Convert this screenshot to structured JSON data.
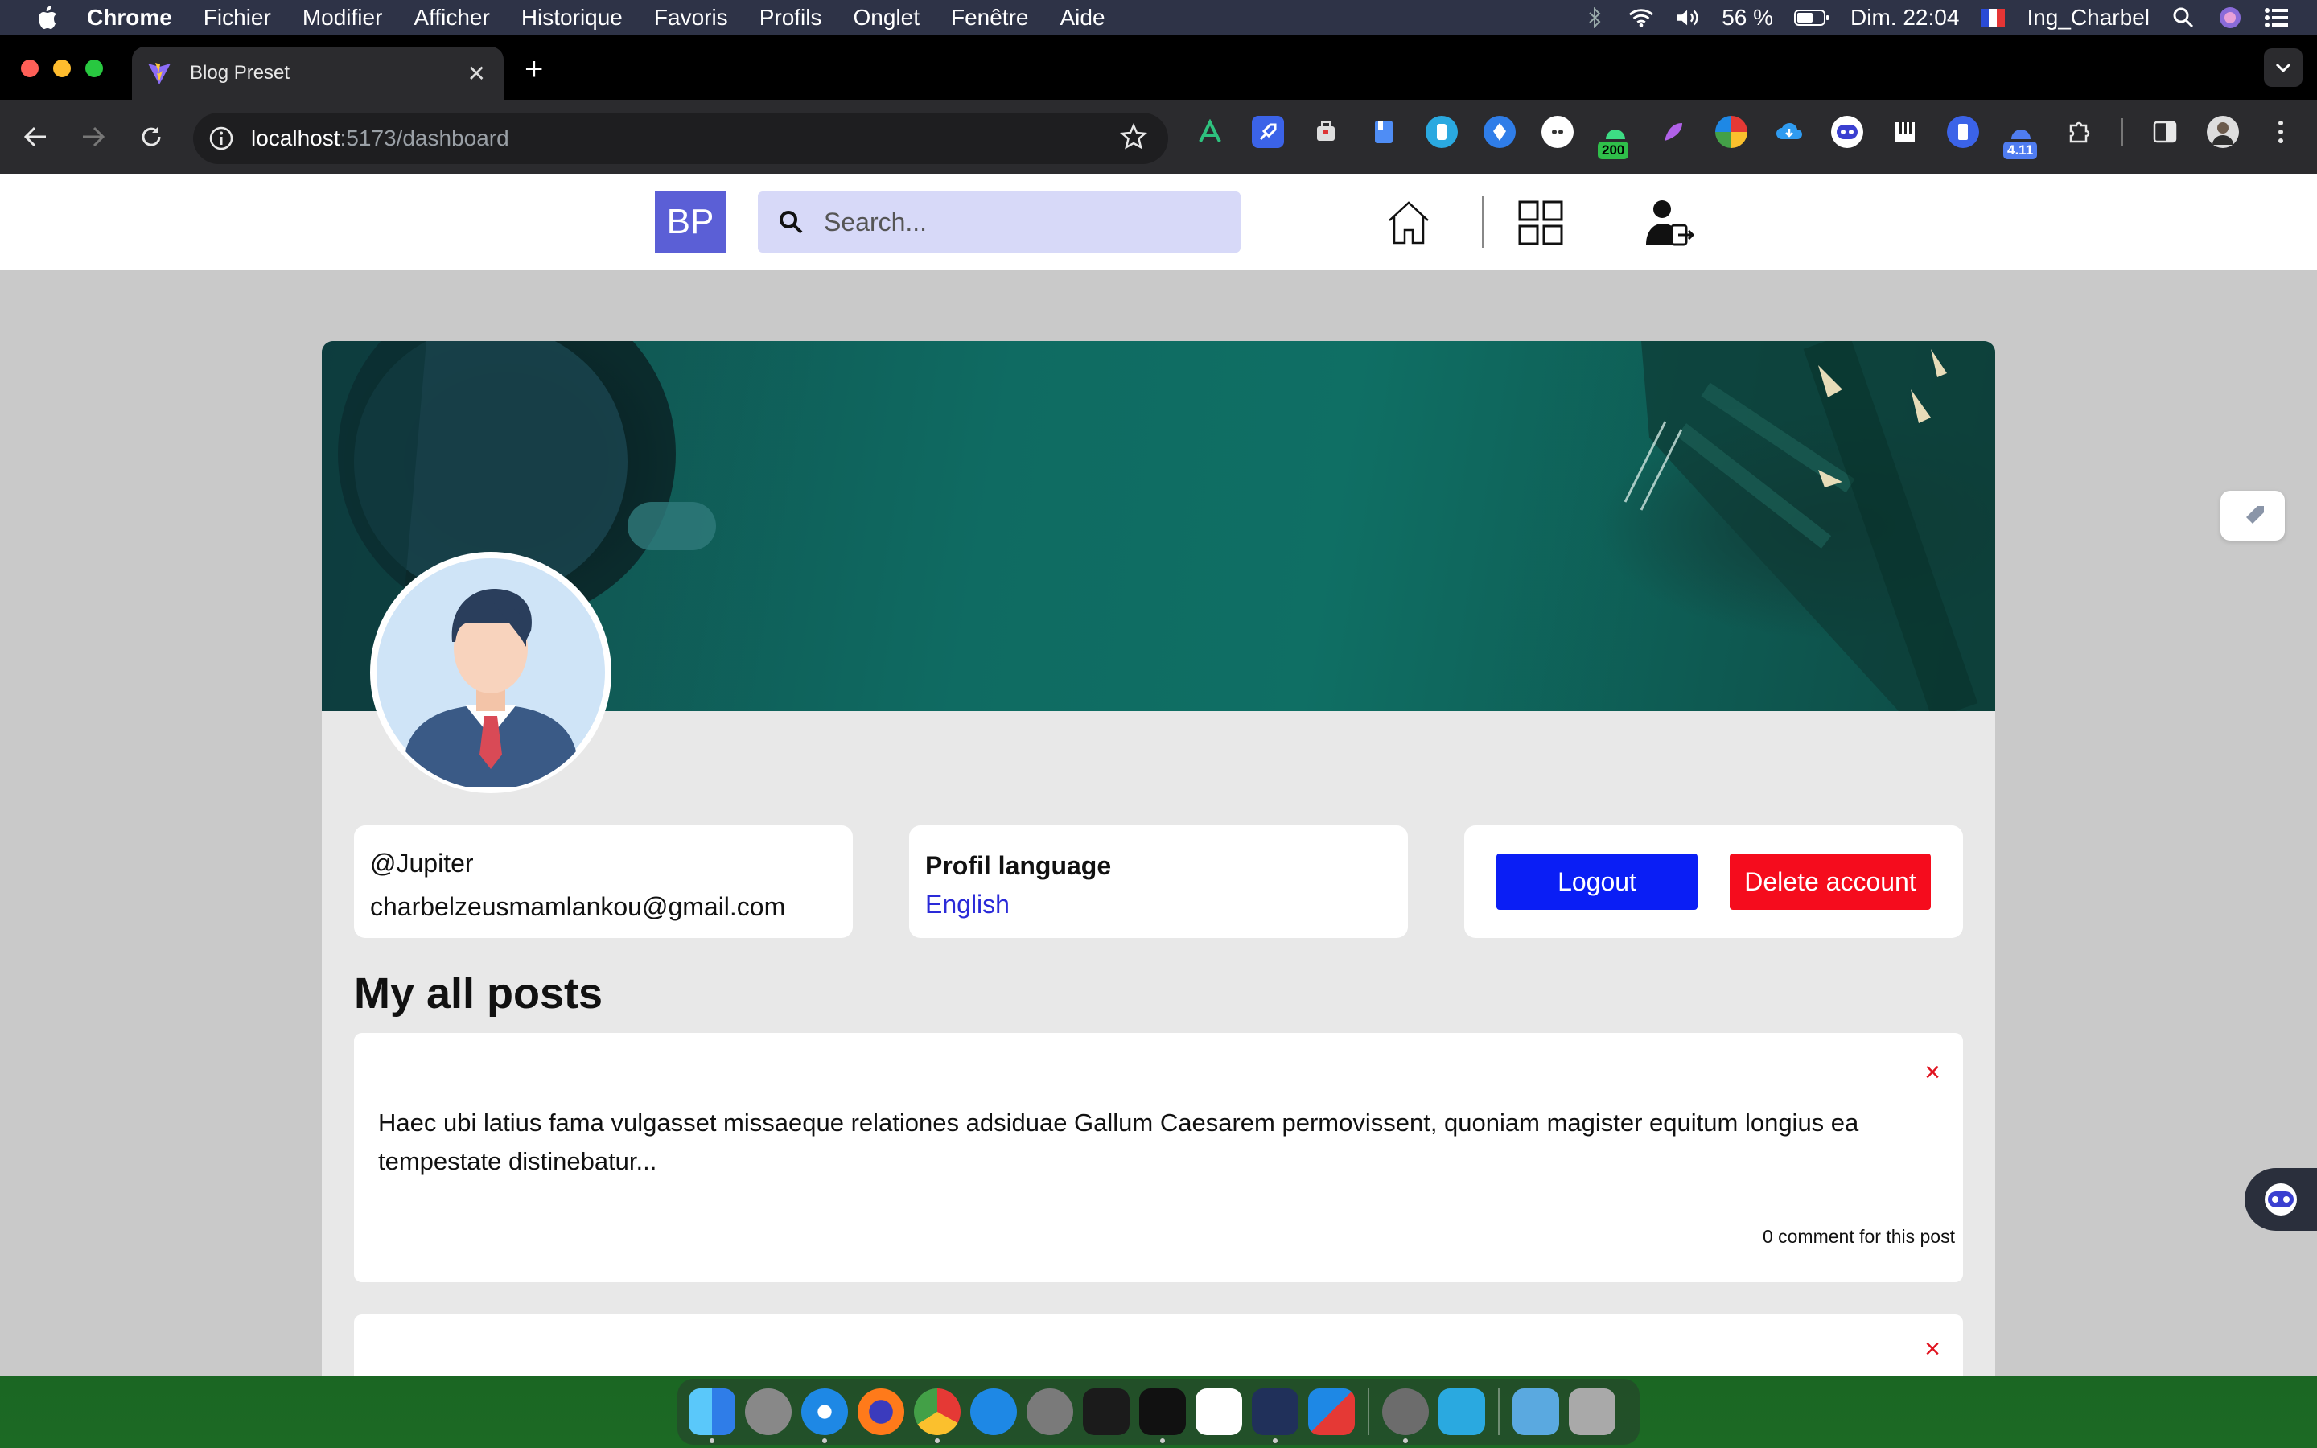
{
  "menubar": {
    "app": "Chrome",
    "items": [
      "Fichier",
      "Modifier",
      "Afficher",
      "Historique",
      "Favoris",
      "Profils",
      "Onglet",
      "Fenêtre",
      "Aide"
    ],
    "battery": "56 %",
    "clock": "Dim. 22:04",
    "user": "Ing_Charbel"
  },
  "browser": {
    "tab_title": "Blog Preset",
    "url_host": "localhost",
    "url_path": ":5173/dashboard",
    "ext_badge_1": "200",
    "ext_badge_2": "4.11"
  },
  "header": {
    "logo": "BP",
    "search_placeholder": "Search..."
  },
  "profile": {
    "handle": "@Jupiter",
    "email": "charbelzeusmamlankou@gmail.com",
    "language_title": "Profil language",
    "language_value": "English",
    "logout_label": "Logout",
    "delete_label": "Delete account"
  },
  "posts": {
    "section_title": "My all posts",
    "items": [
      {
        "excerpt": "Haec ubi latius fama vulgasset missaeque relationes adsiduae Gallum Caesarem permovissent, quoniam magister equitum longius ea tempestate distinebatur...",
        "comments": "0 comment for this post",
        "close": "×"
      },
      {
        "close": "×"
      }
    ]
  },
  "colors": {
    "logo": "#5b5fd6",
    "logout": "#0a1ef5",
    "delete": "#f50c1d",
    "language_link": "#2a2ad8"
  }
}
